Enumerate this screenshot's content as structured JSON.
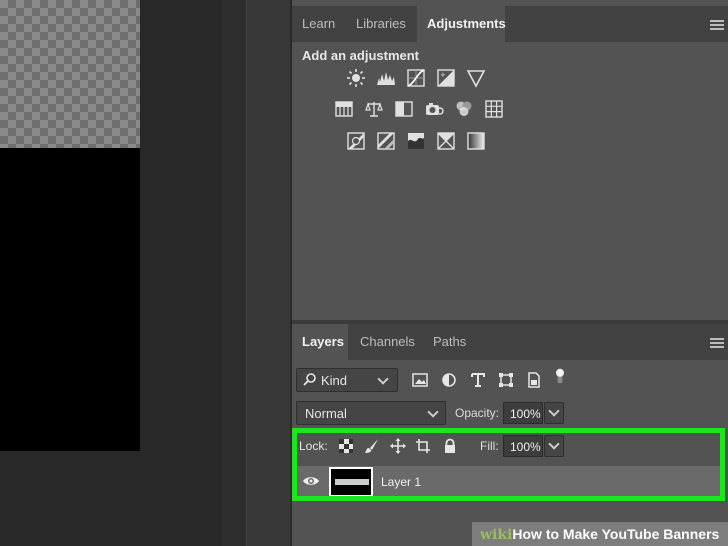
{
  "panels": {
    "top_tabs": [
      {
        "label": "Learn",
        "active": false
      },
      {
        "label": "Libraries",
        "active": false
      },
      {
        "label": "Adjustments",
        "active": true
      }
    ],
    "adjustments": {
      "heading": "Add an adjustment",
      "row1": [
        "brightness-contrast-icon",
        "levels-icon",
        "curves-icon",
        "exposure-icon",
        "vibrance-icon"
      ],
      "row2": [
        "hue-saturation-icon",
        "color-balance-icon",
        "black-white-icon",
        "photo-filter-icon",
        "channel-mixer-icon",
        "color-lookup-icon"
      ],
      "row3": [
        "invert-icon",
        "posterize-icon",
        "threshold-icon",
        "selective-color-icon",
        "gradient-map-icon"
      ]
    },
    "layer_tabs": [
      {
        "label": "Layers",
        "active": true
      },
      {
        "label": "Channels",
        "active": false
      },
      {
        "label": "Paths",
        "active": false
      }
    ]
  },
  "layers": {
    "filter_kind": "Kind",
    "blend_mode": "Normal",
    "opacity_label": "Opacity:",
    "opacity_value": "100%",
    "lock_label": "Lock:",
    "fill_label": "Fill:",
    "fill_value": "100%",
    "layer_name": "Layer 1"
  },
  "watermark": {
    "prefix": "wiki",
    "text": "How to Make YouTube Banners"
  },
  "colors": {
    "highlight": "#1ee61e",
    "panel_bg": "#535353"
  }
}
